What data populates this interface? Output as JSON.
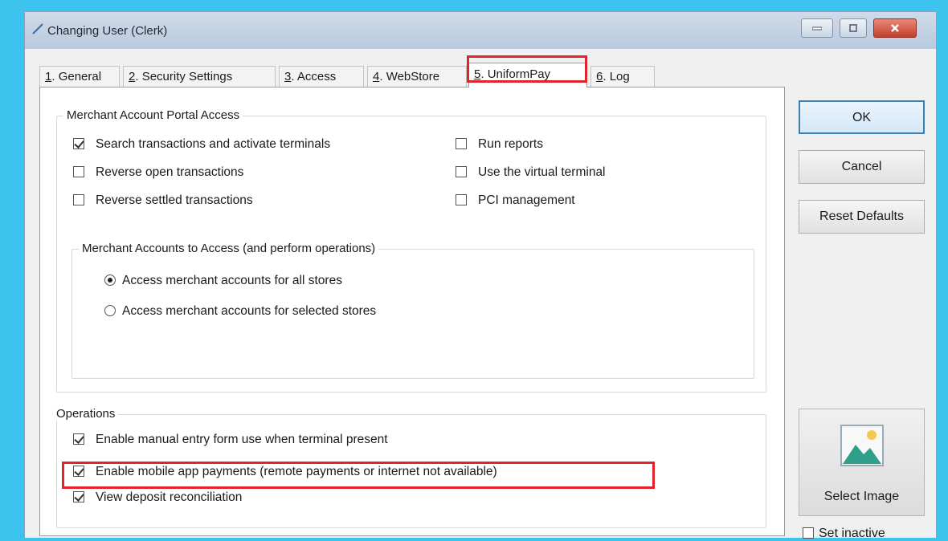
{
  "window": {
    "title": "Changing User  (Clerk)"
  },
  "tabs": [
    {
      "num": "1",
      "label": "General",
      "active": false
    },
    {
      "num": "2",
      "label": "Security Settings",
      "active": false
    },
    {
      "num": "3",
      "label": "Access",
      "active": false
    },
    {
      "num": "4",
      "label": "WebStore",
      "active": false
    },
    {
      "num": "5",
      "label": "UniformPay",
      "active": true
    },
    {
      "num": "6",
      "label": "Log",
      "active": false
    }
  ],
  "portal": {
    "title": "Merchant Account Portal Access",
    "left": [
      {
        "label": "Search transactions and activate terminals",
        "checked": true
      },
      {
        "label": "Reverse open transactions",
        "checked": false
      },
      {
        "label": "Reverse settled transactions",
        "checked": false
      }
    ],
    "right": [
      {
        "label": "Run reports",
        "checked": false
      },
      {
        "label": "Use the virtual terminal",
        "checked": false
      },
      {
        "label": "PCI management",
        "checked": false
      }
    ]
  },
  "accounts": {
    "title": "Merchant Accounts to Access (and perform operations)",
    "options": [
      {
        "label": "Access merchant accounts for all stores",
        "selected": true
      },
      {
        "label": "Access merchant accounts for selected stores",
        "selected": false
      }
    ]
  },
  "operations": {
    "title": "Operations",
    "items": [
      {
        "label": "Enable manual entry form use when terminal present",
        "checked": true
      },
      {
        "label": "Enable mobile app payments (remote payments or internet not available)",
        "checked": true,
        "highlighted": true
      },
      {
        "label": "View deposit reconciliation",
        "checked": true
      }
    ]
  },
  "buttons": {
    "ok": "OK",
    "cancel": "Cancel",
    "reset": "Reset Defaults",
    "select_image": "Select Image"
  },
  "inactive": {
    "label": "Set inactive",
    "checked": false
  },
  "colors": {
    "background": "#3cc4ef",
    "highlight": "#e0242b"
  }
}
